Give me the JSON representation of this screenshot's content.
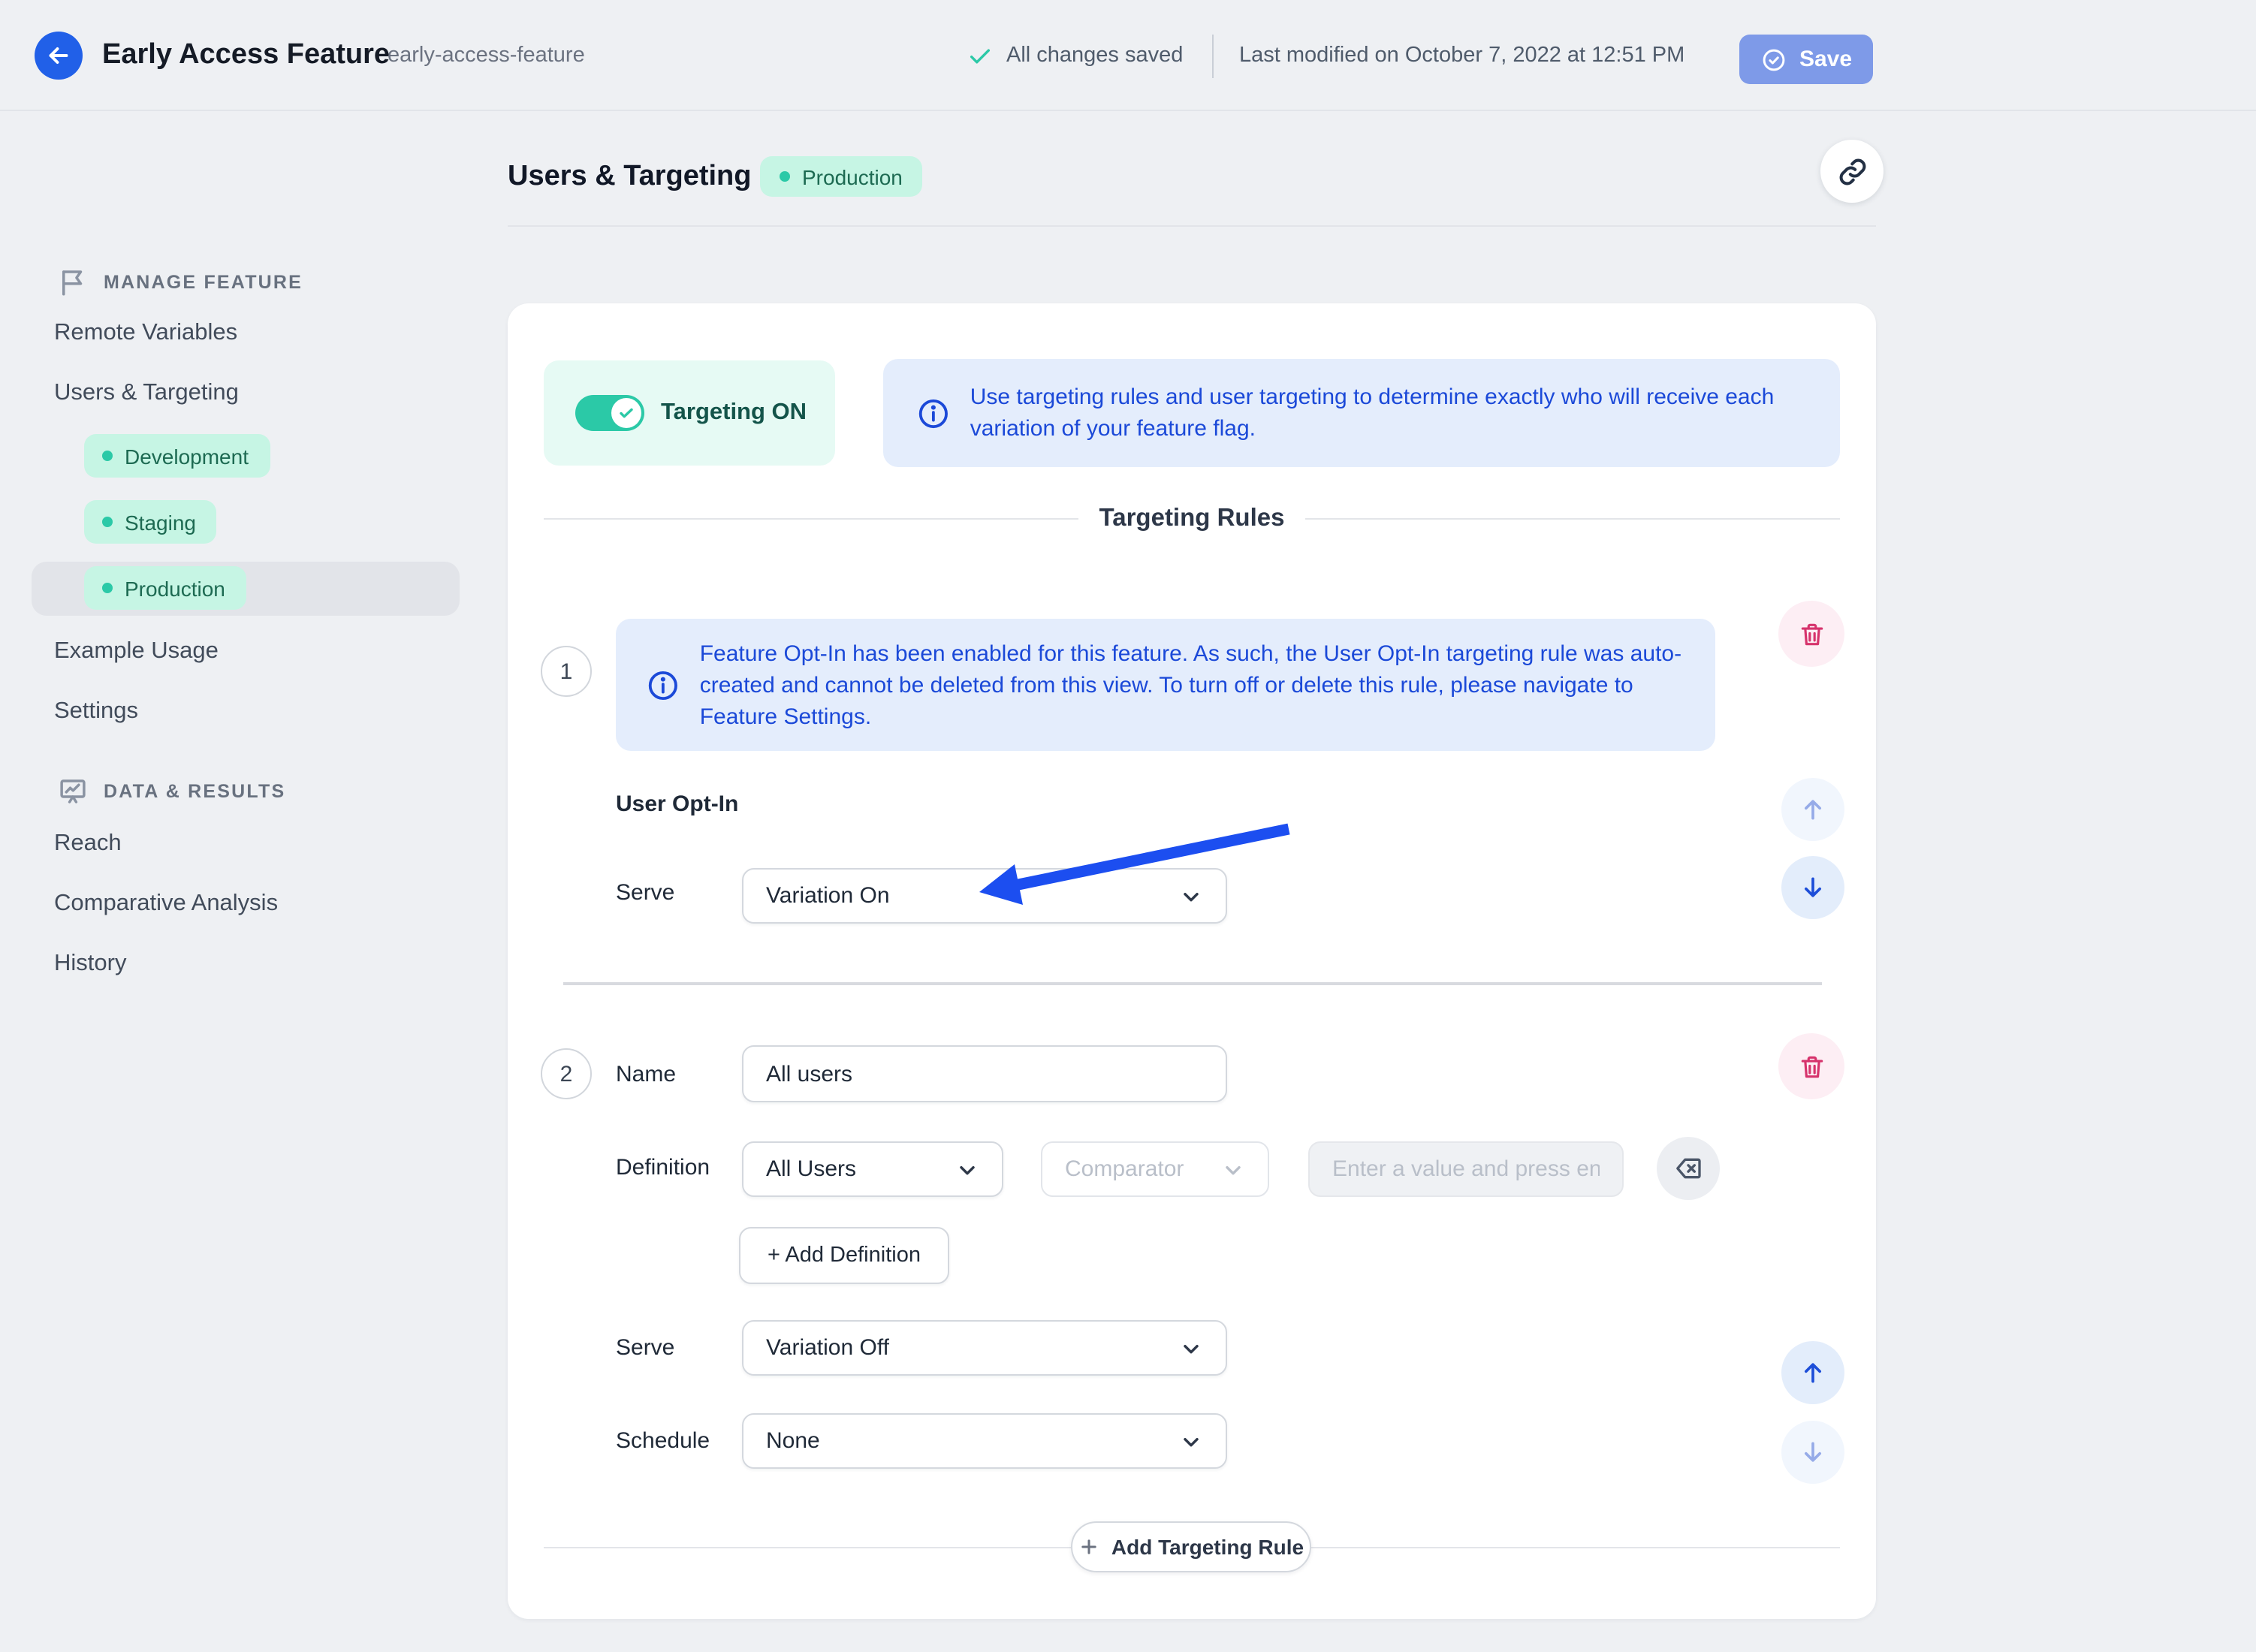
{
  "header": {
    "title": "Early Access Feature",
    "feature_key": "early-access-feature",
    "saved_status": "All changes saved",
    "last_modified": "Last modified on October 7, 2022 at 12:51 PM",
    "save_label": "Save"
  },
  "sidebar": {
    "manage_section_label": "MANAGE FEATURE",
    "data_section_label": "DATA & RESULTS",
    "items": [
      {
        "label": "Remote Variables"
      },
      {
        "label": "Users & Targeting"
      },
      {
        "label": "Example Usage"
      },
      {
        "label": "Settings"
      },
      {
        "label": "Reach"
      },
      {
        "label": "Comparative Analysis"
      },
      {
        "label": "History"
      }
    ],
    "environments": [
      {
        "label": "Development"
      },
      {
        "label": "Staging"
      },
      {
        "label": "Production"
      }
    ],
    "active_environment": "Production"
  },
  "main": {
    "title": "Users & Targeting",
    "environment_badge": "Production",
    "toggle_label": "Targeting ON",
    "banner_text": "Use targeting rules and user targeting to determine exactly who will receive each variation of your feature flag.",
    "rules_title": "Targeting Rules",
    "rule1": {
      "number": "1",
      "notice": "Feature Opt-In has been enabled for this feature. As such, the User Opt-In targeting rule was auto-created and cannot be deleted from this view. To turn off or delete this rule, please navigate to Feature Settings.",
      "title": "User Opt-In",
      "serve_label": "Serve",
      "serve_value": "Variation On"
    },
    "rule2": {
      "number": "2",
      "name_label": "Name",
      "name_value": "All users",
      "definition_label": "Definition",
      "definition_value": "All Users",
      "comparator_placeholder": "Comparator",
      "value_placeholder": "Enter a value and press enter...",
      "add_definition_label": "+ Add Definition",
      "serve_label": "Serve",
      "serve_value": "Variation Off",
      "schedule_label": "Schedule",
      "schedule_value": "None"
    },
    "add_rule_label": "Add Targeting Rule"
  },
  "colors": {
    "accent_teal": "#2bc9a7",
    "accent_blue": "#2160e8",
    "info_blue_text": "#1b49d8",
    "info_blue_bg": "#e4edfc",
    "danger_pink": "#d6336c",
    "mint_pill_bg": "#c6f5e4",
    "annotation_arrow_blue": "#1c4ef0",
    "save_button_bg": "#7e9ae8"
  }
}
